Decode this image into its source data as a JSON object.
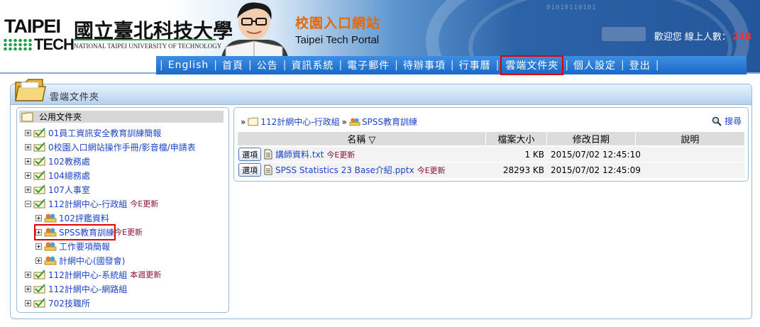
{
  "header": {
    "logo_taipei": "TAIPEI",
    "logo_tech": "TECH",
    "logo_chinese": "國立臺北科技大學",
    "logo_english": "NATIONAL TAIPEI UNIVERSITY OF TECHNOLOGY",
    "portal_title_cn": "校園入口網站",
    "portal_title_en": "Taipei Tech Portal",
    "welcome_text": "歡迎您 線上人數：",
    "online_count": "218",
    "decorative_bits": "01010110101"
  },
  "nav": {
    "items": [
      {
        "label": "English"
      },
      {
        "label": "首頁"
      },
      {
        "label": "公告"
      },
      {
        "label": "資訊系統"
      },
      {
        "label": "電子郵件"
      },
      {
        "label": "待辦事項"
      },
      {
        "label": "行事曆"
      },
      {
        "label": "雲端文件夾"
      },
      {
        "label": "個人設定"
      },
      {
        "label": "登出"
      }
    ],
    "active": "雲端文件夾"
  },
  "panel": {
    "title": "雲端文件夾"
  },
  "tree": {
    "root_label": "公用文件夾",
    "nodes": [
      {
        "label": "01員工資訊安全教育訓練簡報",
        "new": ""
      },
      {
        "label": "0校園入口網站操作手冊/影音檔/申請表",
        "new": ""
      },
      {
        "label": "102教務處",
        "new": ""
      },
      {
        "label": "104總務處",
        "new": ""
      },
      {
        "label": "107人事室",
        "new": ""
      },
      {
        "label": "112計網中心-行政組",
        "new": "今E更新"
      },
      {
        "label": "102評鑑資料",
        "new": ""
      },
      {
        "label": "SPSS教育訓練",
        "new": "今E更新"
      },
      {
        "label": "工作要項簡報",
        "new": ""
      },
      {
        "label": "計網中心(國發會)",
        "new": ""
      },
      {
        "label": "112計網中心-系統組",
        "new": "本週更新"
      },
      {
        "label": "112計網中心-網路組",
        "new": ""
      },
      {
        "label": "702技職所",
        "new": ""
      }
    ]
  },
  "list": {
    "breadcrumb": [
      "»",
      "112計網中心-行政組",
      "»",
      "SPSS教育訓練"
    ],
    "search_label": "搜尋",
    "columns": {
      "name": "名稱 ▽",
      "size": "檔案大小",
      "date": "修改日期",
      "desc": "說明"
    },
    "rows": [
      {
        "option": "選項",
        "name": "講師資料.txt",
        "new": "今E更新",
        "size": "1 KB",
        "date": "2015/07/02 12:45:10",
        "desc": ""
      },
      {
        "option": "選項",
        "name": "SPSS Statistics 23 Base介紹.pptx",
        "new": "今E更新",
        "size": "28293 KB",
        "date": "2015/07/02 12:45:09",
        "desc": ""
      }
    ]
  },
  "colors": {
    "nav_blue": "#1b68c7",
    "link_blue": "#1d44c7",
    "highlight_red": "#e00000",
    "portal_orange": "#e36a0a",
    "update_text": "#8a0f3b"
  }
}
